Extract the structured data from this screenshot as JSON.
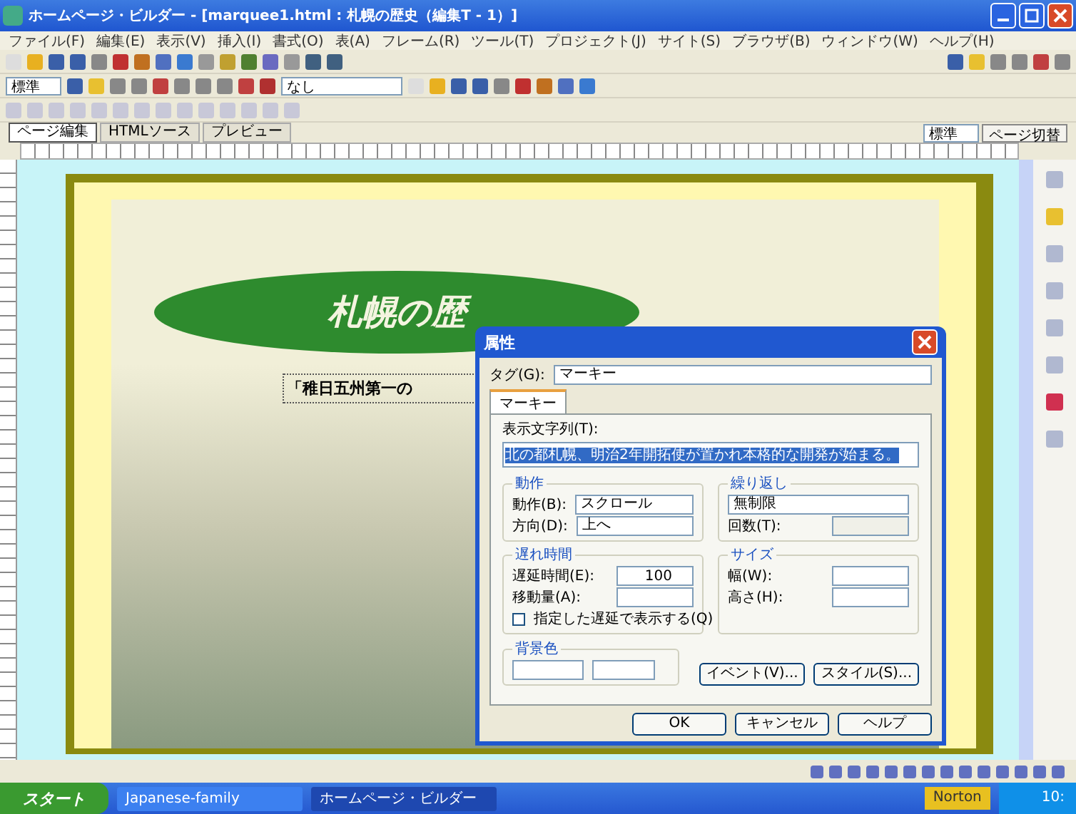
{
  "window": {
    "title": "ホームページ・ビルダー - [marquee1.html : 札幌の歴史（編集T - 1）]"
  },
  "menu": [
    "ファイル(F)",
    "編集(E)",
    "表示(V)",
    "挿入(I)",
    "書式(O)",
    "表(A)",
    "フレーム(R)",
    "ツール(T)",
    "プロジェクト(J)",
    "サイト(S)",
    "ブラウザ(B)",
    "ウィンドウ(W)",
    "ヘルプ(H)"
  ],
  "format_bar": {
    "style": "標準",
    "font": "なし"
  },
  "view_tabs": [
    {
      "label": "ページ編集",
      "selected": true
    },
    {
      "label": "HTMLソース",
      "selected": false
    },
    {
      "label": "プレビュー",
      "selected": false
    }
  ],
  "view_mode": {
    "mode": "標準",
    "switch": "ページ切替"
  },
  "page": {
    "heading": "札幌の歴",
    "marquee": "「稚日五州第一の"
  },
  "dialog": {
    "title": "属性",
    "tag_label": "タグ(G):",
    "tag_value": "マーキー",
    "tab": "マーキー",
    "text_label": "表示文字列(T):",
    "text_value": "北の都札幌、明治2年開拓使が置かれ本格的な開発が始まる。",
    "motion": {
      "title": "動作",
      "rows": [
        {
          "label": "動作(B):",
          "value": "スクロール"
        },
        {
          "label": "方向(D):",
          "value": "上へ"
        }
      ]
    },
    "repeat": {
      "title": "繰り返し",
      "value": "無制限",
      "count_label": "回数(T):"
    },
    "speed": {
      "title": "遅れ時間",
      "rows": [
        {
          "label": "遅延時間(E):",
          "value": "100"
        },
        {
          "label": "移動量(A):"
        }
      ],
      "checkbox": {
        "label": "指定した遅延で表示する(Q)",
        "checked": false
      }
    },
    "size": {
      "title": "サイズ",
      "rows": [
        {
          "label": "幅(W):"
        },
        {
          "label": "高さ(H):"
        }
      ]
    },
    "bg": {
      "title": "背景色"
    },
    "side_buttons": [
      "イベント(V)...",
      "スタイル(S)..."
    ],
    "buttons": [
      "OK",
      "キャンセル",
      "ヘルプ"
    ]
  },
  "taskbar": {
    "start": "スタート",
    "tasks": [
      {
        "label": "Japanese-family",
        "selected": false
      },
      {
        "label": "ホームページ・ビルダー",
        "selected": true
      }
    ],
    "tray": "Norton",
    "clock": "10:"
  }
}
